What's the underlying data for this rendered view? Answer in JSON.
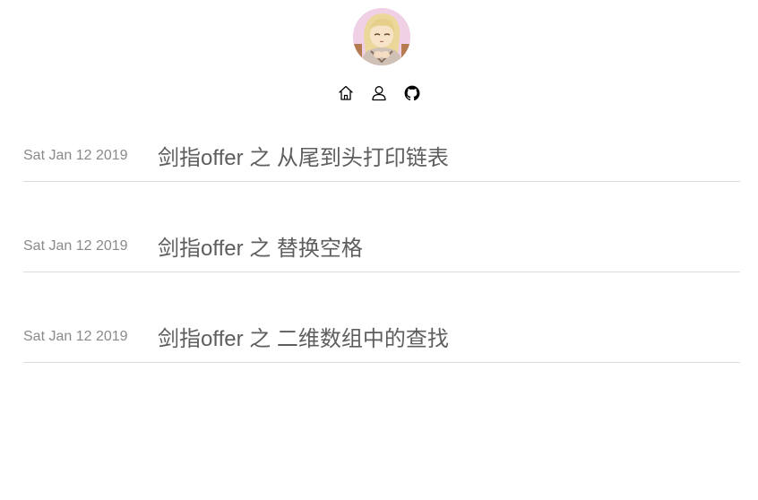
{
  "nav": {
    "items": [
      {
        "icon": "home-icon"
      },
      {
        "icon": "user-icon"
      },
      {
        "icon": "github-icon"
      }
    ]
  },
  "posts": [
    {
      "date": "Sat Jan 12 2019",
      "title": "剑指offer 之 从尾到头打印链表"
    },
    {
      "date": "Sat Jan 12 2019",
      "title": "剑指offer 之 替换空格"
    },
    {
      "date": "Sat Jan 12 2019",
      "title": "剑指offer 之 二维数组中的查找"
    }
  ]
}
